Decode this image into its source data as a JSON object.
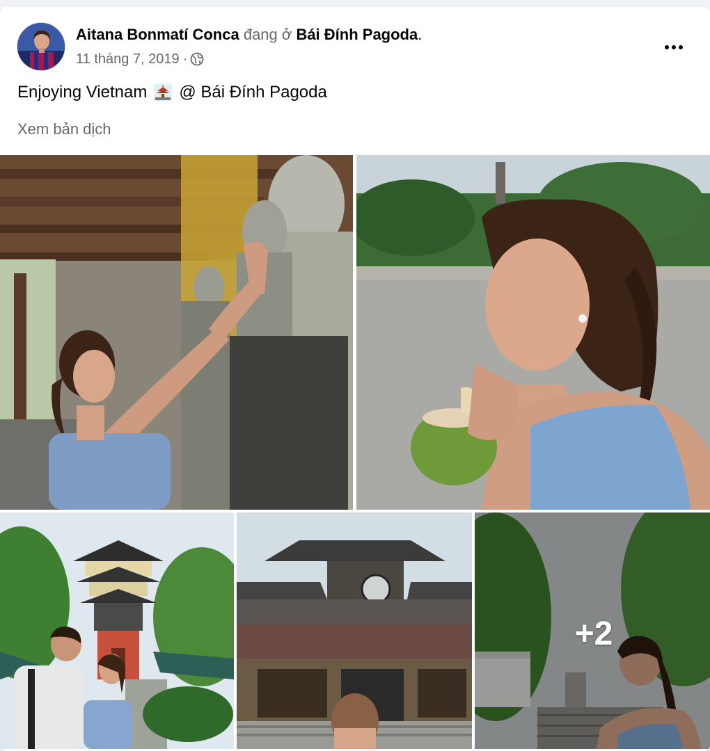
{
  "post": {
    "author": "Aitana Bonmatí Conca",
    "at_text": "đang ở",
    "place": "Bái Đính Pagoda",
    "place_suffix": ".",
    "date": "11 tháng 7, 2019",
    "date_separator": "·",
    "privacy_icon": "globe-icon",
    "more_icon": "more-options-icon",
    "caption_start": "Enjoying Vietnam",
    "caption_emoji": "pagoda-emoji-icon",
    "caption_end": "@ Bái Đính Pagoda",
    "see_translation": "Xem bản dịch"
  },
  "photos": {
    "extra_count": "+2",
    "items": [
      {
        "name": "photo-temple-statues"
      },
      {
        "name": "photo-coconut-drink"
      },
      {
        "name": "photo-bell-tower"
      },
      {
        "name": "photo-temple-hall"
      },
      {
        "name": "photo-stairway"
      }
    ]
  },
  "colors": {
    "text_primary": "#050505",
    "text_secondary": "#65676b",
    "card_bg": "#ffffff",
    "page_bg": "#f0f2f5"
  }
}
